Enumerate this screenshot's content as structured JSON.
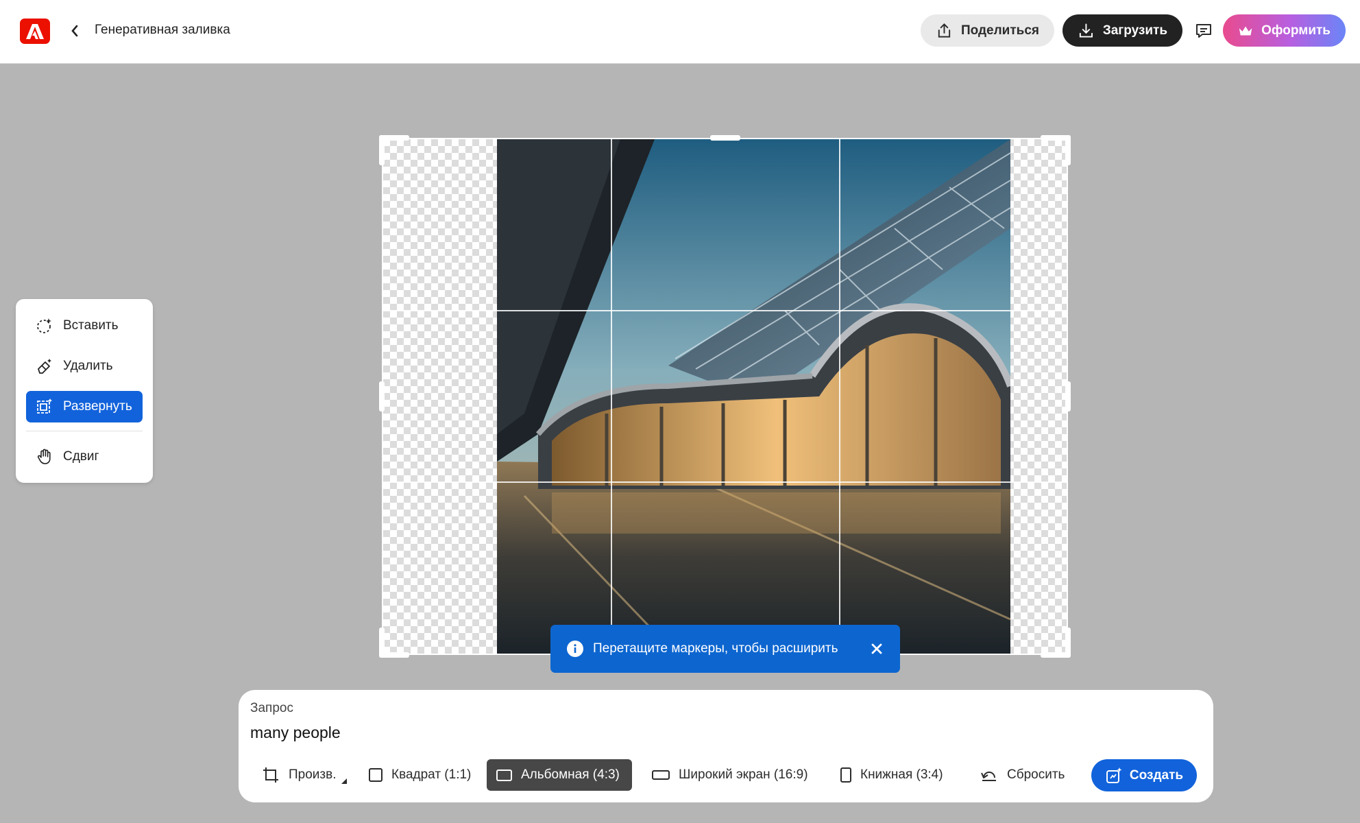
{
  "header": {
    "title": "Генеративная заливка",
    "share_label": "Поделиться",
    "download_label": "Загрузить",
    "design_label": "Оформить",
    "brand_color": "#eb1000"
  },
  "tools": {
    "items": [
      {
        "label": "Вставить",
        "icon": "insert-icon"
      },
      {
        "label": "Удалить",
        "icon": "eraser-icon"
      },
      {
        "label": "Развернуть",
        "icon": "expand-icon",
        "active": true
      },
      {
        "label": "Сдвиг",
        "icon": "hand-icon"
      }
    ]
  },
  "toast": {
    "text": "Перетащите маркеры, чтобы расширить"
  },
  "prompt": {
    "label": "Запрос",
    "value": "many people"
  },
  "ratios": [
    {
      "label": "Произв.",
      "icon": "crop-icon"
    },
    {
      "label": "Квадрат (1:1)",
      "icon": "square-icon"
    },
    {
      "label": "Альбомная (4:3)",
      "icon": "landscape-icon",
      "active": true
    },
    {
      "label": "Широкий экран (16:9)",
      "icon": "widescreen-icon"
    },
    {
      "label": "Книжная (3:4)",
      "icon": "portrait-icon"
    },
    {
      "label": "Сбросить",
      "icon": "reset-icon"
    }
  ],
  "create_label": "Создать",
  "accent_color": "#1263db"
}
